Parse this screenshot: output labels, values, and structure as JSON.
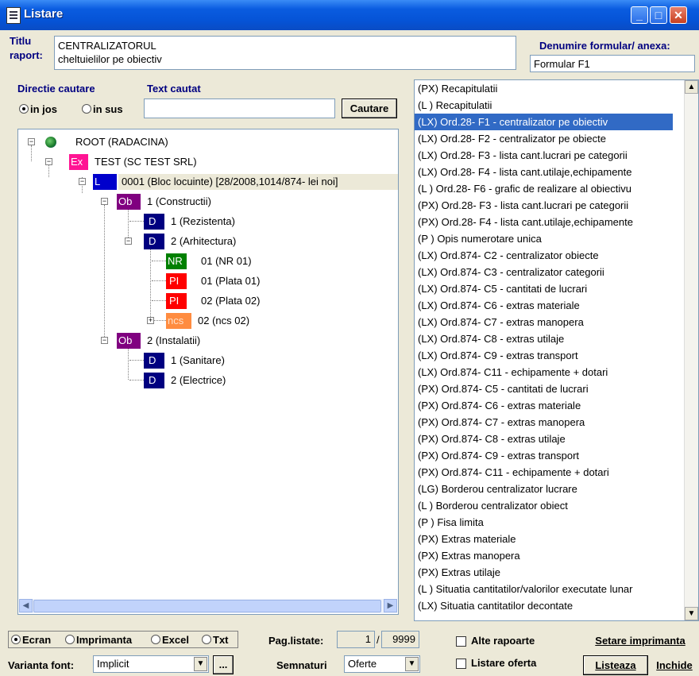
{
  "window": {
    "title": "Listare"
  },
  "header": {
    "titlu_label_1": "Titlu",
    "titlu_label_2": "raport:",
    "title_line1": "CENTRALIZATORUL",
    "title_line2": "cheltuielilor pe obiectiv",
    "form_label": "Denumire formular/ anexa:",
    "form_value": "Formular F1"
  },
  "search": {
    "direction_label": "Directie cautare",
    "text_label": "Text cautat",
    "down_label": "in jos",
    "up_label": "in sus",
    "text_value": "",
    "button": "Cautare"
  },
  "tree": {
    "nodes": [
      {
        "badge": "",
        "text": "ROOT (RADACINA)"
      },
      {
        "badge": "Ex",
        "text": "TEST (SC TEST SRL)"
      },
      {
        "badge": "L",
        "text": "0001 (Bloc locuinte) [28/2008,1014/874- lei noi]"
      },
      {
        "badge": "Ob",
        "text": "1 (Constructii)"
      },
      {
        "badge": "D",
        "text": "1 (Rezistenta)"
      },
      {
        "badge": "D",
        "text": "2 (Arhitectura)"
      },
      {
        "badge": "NR",
        "text": "01 (NR 01)"
      },
      {
        "badge": "PI",
        "text": "01 (Plata 01)"
      },
      {
        "badge": "PI",
        "text": "02 (Plata 02)"
      },
      {
        "badge": "ncs",
        "text": "02 (ncs 02)"
      },
      {
        "badge": "Ob",
        "text": "2 (Instalatii)"
      },
      {
        "badge": "D",
        "text": "1 (Sanitare)"
      },
      {
        "badge": "D",
        "text": "2 (Electrice)"
      }
    ]
  },
  "reports": [
    "(PX) Recapitulatii",
    "(L ) Recapitulatii",
    "(LX) Ord.28- F1 - centralizator pe obiectiv",
    "(LX) Ord.28- F2 - centralizator pe obiecte",
    "(LX) Ord.28- F3 - lista cant.lucrari pe categorii",
    "(LX) Ord.28- F4 - lista cant.utilaje,echipamente",
    "(L ) Ord.28- F6 - grafic de realizare al obiectivu",
    "(PX) Ord.28- F3 - lista cant.lucrari pe categorii",
    "(PX) Ord.28- F4 - lista cant.utilaje,echipamente",
    "(P ) Opis numerotare unica",
    "(LX) Ord.874- C2 - centralizator obiecte",
    "(LX) Ord.874- C3 - centralizator categorii",
    "(LX) Ord.874- C5 - cantitati de lucrari",
    "(LX) Ord.874- C6 - extras materiale",
    "(LX) Ord.874- C7 - extras manopera",
    "(LX) Ord.874- C8 - extras utilaje",
    "(LX) Ord.874- C9 - extras transport",
    "(LX) Ord.874- C11 - echipamente + dotari",
    "(PX) Ord.874- C5 - cantitati de lucrari",
    "(PX) Ord.874- C6 - extras materiale",
    "(PX) Ord.874- C7 - extras manopera",
    "(PX) Ord.874- C8 - extras utilaje",
    "(PX) Ord.874- C9 - extras transport",
    "(PX) Ord.874- C11 - echipamente + dotari",
    "(LG) Borderou centralizator lucrare",
    "(L ) Borderou centralizator obiect",
    "(P ) Fisa limita",
    "(PX) Extras materiale",
    "(PX) Extras manopera",
    "(PX) Extras utilaje",
    "(L ) Situatia cantitatilor/valorilor executate lunar",
    "(LX) Situatia cantitatilor decontate"
  ],
  "selected_report_index": 2,
  "output": {
    "ecran": "Ecran",
    "imprimanta": "Imprimanta",
    "excel": "Excel",
    "txt": "Txt",
    "font_label": "Varianta font:",
    "font_value": "Implicit",
    "more_button": "..."
  },
  "pages": {
    "label": "Pag.listate:",
    "current": "1",
    "separator": "/",
    "total": "9999",
    "sign_label": "Semnaturi",
    "sign_value": "Oferte"
  },
  "options": {
    "alte": "Alte rapoarte",
    "oferta": "Listare oferta"
  },
  "actions": {
    "setare": "Setare imprimanta",
    "listeaza": "Listeaza",
    "inchide": "Inchide"
  },
  "colors": {
    "Ex": "#ff1493",
    "L": "#0000cc",
    "Ob": "#800080",
    "D": "#000080",
    "NR": "#008000",
    "PI": "#ff0000",
    "ncs": "#ff8c40",
    "selection": "#316ac5"
  }
}
